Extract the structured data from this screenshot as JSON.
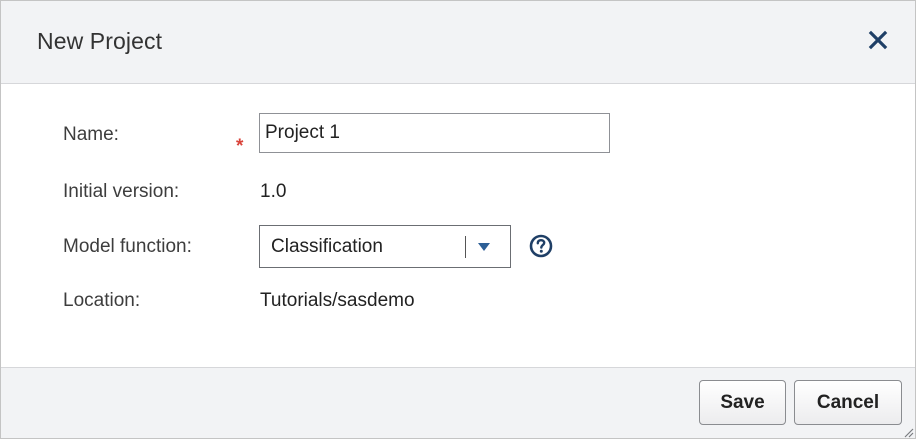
{
  "dialog": {
    "title": "New Project",
    "close_icon": "close-icon"
  },
  "form": {
    "name_label": "Name:",
    "required_marker": "*",
    "name_value": "Project 1",
    "version_label": "Initial version:",
    "version_value": "1.0",
    "function_label": "Model function:",
    "function_value": "Classification",
    "help_icon": "question-circle-icon",
    "location_label": "Location:",
    "location_value": "Tutorials/sasdemo"
  },
  "footer": {
    "save_label": "Save",
    "cancel_label": "Cancel",
    "resize_icon": "resize-grip-icon"
  },
  "colors": {
    "header_bg": "#f2f3f5",
    "required": "#d9433a",
    "accent": "#2d5f96"
  }
}
